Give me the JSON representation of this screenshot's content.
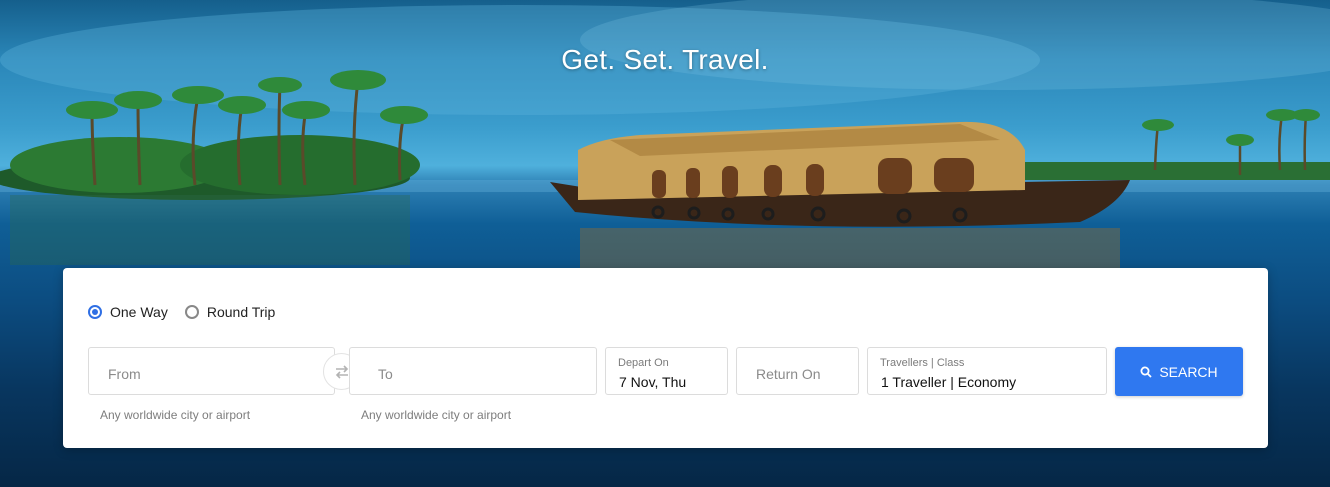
{
  "hero": {
    "tagline": "Get. Set. Travel."
  },
  "search": {
    "trip_types": [
      {
        "label": "One Way",
        "selected": true
      },
      {
        "label": "Round Trip",
        "selected": false
      }
    ],
    "from": {
      "placeholder": "From",
      "hint": "Any worldwide city or airport"
    },
    "to": {
      "placeholder": "To",
      "hint": "Any worldwide city or airport"
    },
    "depart": {
      "label": "Depart On",
      "value": "7 Nov, Thu"
    },
    "return": {
      "placeholder": "Return On"
    },
    "travellers": {
      "label": "Travellers | Class",
      "value": "1 Traveller | Economy"
    },
    "swap_icon": "swap-arrows-icon",
    "search_icon": "search-icon",
    "search_label": "SEARCH"
  },
  "colors": {
    "accent": "#2f78f0",
    "radio_selected": "#2f6fe4",
    "panel_background": "#ffffff"
  }
}
